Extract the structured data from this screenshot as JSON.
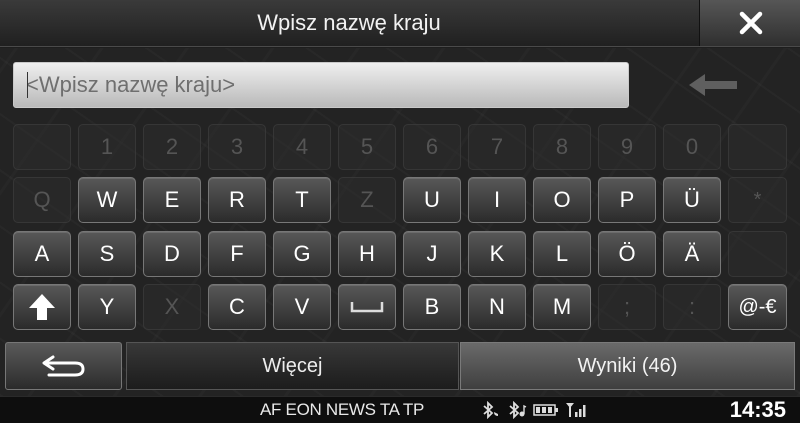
{
  "header": {
    "title": "Wpisz nazwę kraju",
    "close_icon": "close-icon"
  },
  "search": {
    "value": "",
    "placeholder": "<Wpisz nazwę kraju>",
    "backspace_icon": "backspace-arrow-icon"
  },
  "keyboard": {
    "rows": [
      {
        "keys": [
          {
            "label": "",
            "enabled": false
          },
          {
            "label": "1",
            "enabled": false
          },
          {
            "label": "2",
            "enabled": false
          },
          {
            "label": "3",
            "enabled": false
          },
          {
            "label": "4",
            "enabled": false
          },
          {
            "label": "5",
            "enabled": false
          },
          {
            "label": "6",
            "enabled": false
          },
          {
            "label": "7",
            "enabled": false
          },
          {
            "label": "8",
            "enabled": false
          },
          {
            "label": "9",
            "enabled": false
          },
          {
            "label": "0",
            "enabled": false
          },
          {
            "label": "",
            "enabled": false
          }
        ]
      },
      {
        "keys": [
          {
            "label": "Q",
            "enabled": false
          },
          {
            "label": "W",
            "enabled": true
          },
          {
            "label": "E",
            "enabled": true
          },
          {
            "label": "R",
            "enabled": true
          },
          {
            "label": "T",
            "enabled": true
          },
          {
            "label": "Z",
            "enabled": false
          },
          {
            "label": "U",
            "enabled": true
          },
          {
            "label": "I",
            "enabled": true
          },
          {
            "label": "O",
            "enabled": true
          },
          {
            "label": "P",
            "enabled": true
          },
          {
            "label": "Ü",
            "enabled": true
          },
          {
            "label": "*",
            "enabled": false
          }
        ]
      },
      {
        "keys": [
          {
            "label": "A",
            "enabled": true
          },
          {
            "label": "S",
            "enabled": true
          },
          {
            "label": "D",
            "enabled": true
          },
          {
            "label": "F",
            "enabled": true
          },
          {
            "label": "G",
            "enabled": true
          },
          {
            "label": "H",
            "enabled": true
          },
          {
            "label": "J",
            "enabled": true
          },
          {
            "label": "K",
            "enabled": true
          },
          {
            "label": "L",
            "enabled": true
          },
          {
            "label": "Ö",
            "enabled": true
          },
          {
            "label": "Ä",
            "enabled": true
          },
          {
            "label": "",
            "enabled": false
          }
        ]
      },
      {
        "keys": [
          {
            "label": "",
            "enabled": true,
            "icon": "shift-icon"
          },
          {
            "label": "Y",
            "enabled": true
          },
          {
            "label": "X",
            "enabled": false
          },
          {
            "label": "C",
            "enabled": true
          },
          {
            "label": "V",
            "enabled": true
          },
          {
            "label": "",
            "enabled": true,
            "icon": "space-icon"
          },
          {
            "label": "B",
            "enabled": true
          },
          {
            "label": "N",
            "enabled": true
          },
          {
            "label": "M",
            "enabled": true
          },
          {
            "label": ";",
            "enabled": false
          },
          {
            "label": ":",
            "enabled": false
          },
          {
            "label": "@-€",
            "enabled": true
          }
        ]
      }
    ]
  },
  "bottom": {
    "back_icon": "return-arrow-icon",
    "more_label": "Więcej",
    "results_label": "Wyniki (46)"
  },
  "status": {
    "rds": "AF EON NEWS TA TP",
    "icons": [
      "bluetooth-phone-icon",
      "bluetooth-audio-icon",
      "battery-icon",
      "signal-icon"
    ],
    "clock": "14:35"
  }
}
